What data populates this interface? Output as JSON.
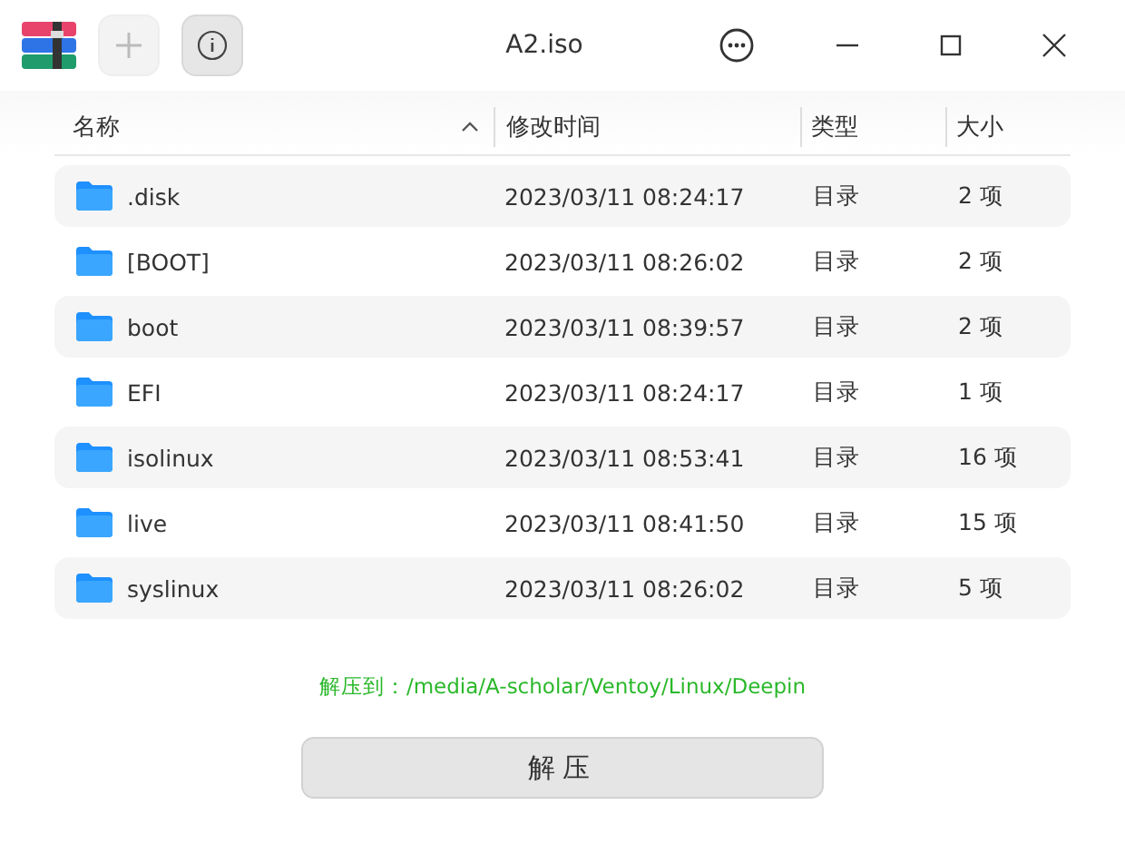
{
  "window": {
    "title": "A2.iso"
  },
  "toolbar": {
    "add_disabled": true
  },
  "table": {
    "columns": [
      {
        "label": "名称",
        "sorted": true
      },
      {
        "label": "修改时间",
        "sorted": false
      },
      {
        "label": "类型",
        "sorted": false
      },
      {
        "label": "大小",
        "sorted": false
      }
    ],
    "rows": [
      {
        "name": ".disk",
        "modified": "2023/03/11 08:24:17",
        "type": "目录",
        "size": "2 项"
      },
      {
        "name": "[BOOT]",
        "modified": "2023/03/11 08:26:02",
        "type": "目录",
        "size": "2 项"
      },
      {
        "name": "boot",
        "modified": "2023/03/11 08:39:57",
        "type": "目录",
        "size": "2 项"
      },
      {
        "name": "EFI",
        "modified": "2023/03/11 08:24:17",
        "type": "目录",
        "size": "1 项"
      },
      {
        "name": "isolinux",
        "modified": "2023/03/11 08:53:41",
        "type": "目录",
        "size": "16 项"
      },
      {
        "name": "live",
        "modified": "2023/03/11 08:41:50",
        "type": "目录",
        "size": "15 项"
      },
      {
        "name": "syslinux",
        "modified": "2023/03/11 08:26:02",
        "type": "目录",
        "size": "5 项"
      }
    ]
  },
  "extract_path": "解压到：/media/A-scholar/Ventoy/Linux/Deepin",
  "extract_button": "解压"
}
